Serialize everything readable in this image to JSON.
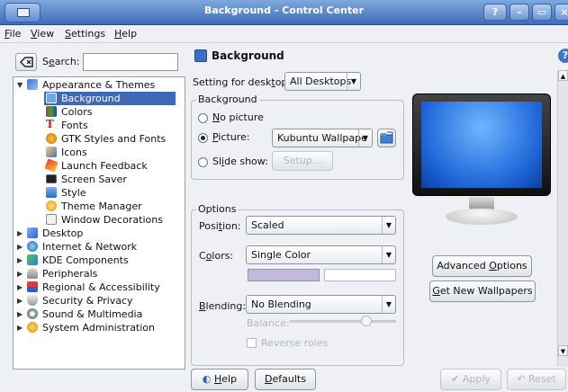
{
  "window": {
    "title": "Background - Control Center",
    "controls": [
      "?",
      "–",
      "▭",
      "×"
    ]
  },
  "menu": [
    {
      "label": "File",
      "u": "F",
      "rest": "ile"
    },
    {
      "label": "View",
      "u": "V",
      "rest": "iew"
    },
    {
      "label": "Settings",
      "u": "S",
      "rest": "ettings"
    },
    {
      "label": "Help",
      "u": "H",
      "rest": "elp"
    }
  ],
  "search": {
    "label_u": "e",
    "label_pre": "S",
    "label_post": "arch:",
    "value": ""
  },
  "tree": {
    "appearance": "Appearance & Themes",
    "children": [
      "Background",
      "Colors",
      "Fonts",
      "GTK Styles and Fonts",
      "Icons",
      "Launch Feedback",
      "Screen Saver",
      "Style",
      "Theme Manager",
      "Window Decorations"
    ],
    "selected": "Background",
    "top_level": [
      "Desktop",
      "Internet & Network",
      "KDE Components",
      "Peripherals",
      "Regional & Accessibility",
      "Security & Privacy",
      "Sound & Multimedia",
      "System Administration"
    ]
  },
  "header": {
    "title": "Background",
    "help": "?"
  },
  "desktop": {
    "label_pre": "Setting for desk",
    "label_u": "t",
    "label_post": "op:",
    "value": "All Desktops"
  },
  "background_group": {
    "title": "Background",
    "no_picture": {
      "u": "N",
      "rest": "o picture"
    },
    "picture": {
      "u": "P",
      "rest": "icture:"
    },
    "picture_value": "Kubuntu Wallpape",
    "slideshow": {
      "pre": "Sl",
      "u": "i",
      "rest": "de show:"
    },
    "setup": "Setup..."
  },
  "options_group": {
    "title": "Options",
    "position": {
      "pre": "Posi",
      "u": "t",
      "rest": "ion:",
      "value": "Scaled"
    },
    "colors": {
      "pre": "C",
      "u": "o",
      "rest": "lors:",
      "value": "Single Color"
    },
    "blending": {
      "pre": "",
      "u": "B",
      "rest": "lending:",
      "value": "No Blending"
    },
    "balance": "Balance:",
    "balance_level": 0.72,
    "reverse": "Reverse roles"
  },
  "colors": {
    "swatch1": "#c3b9dc",
    "swatch2": "#ffffff",
    "accent": "#3f68b5"
  },
  "buttons": {
    "advanced": {
      "pre": "Advanced ",
      "u": "O",
      "rest": "ptions"
    },
    "new_wallpapers": {
      "pre": "",
      "u": "G",
      "rest": "et New Wallpapers"
    },
    "help": {
      "pre": "",
      "u": "H",
      "rest": "elp"
    },
    "defaults": {
      "pre": "",
      "u": "D",
      "rest": "efaults"
    },
    "apply": "Apply",
    "reset": "Reset"
  }
}
